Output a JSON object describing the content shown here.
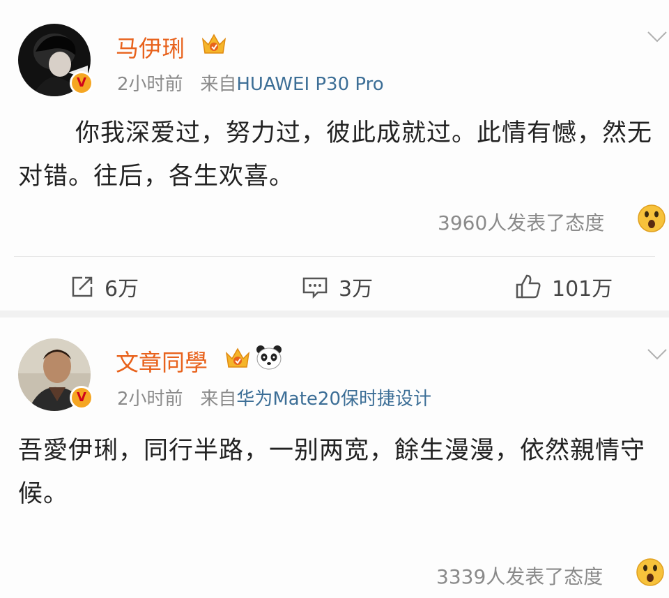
{
  "posts": [
    {
      "username": "马伊琍",
      "time": "2小时前",
      "source_prefix": "来自",
      "source": "HUAWEI P30 Pro",
      "content": "你我深爱过，努力过，彼此成就过。此情有憾，然无对错。往后，各生欢喜。",
      "reactions": "3960人发表了态度",
      "actions": {
        "repost": "6万",
        "comment": "3万",
        "like": "101万"
      },
      "badge_icon": "crown-badge-icon",
      "verified_icon": "verified-v-icon"
    },
    {
      "username": "文章同學",
      "time": "2小时前",
      "source_prefix": "来自",
      "source": "华为Mate20保时捷设计",
      "content": "吾愛伊琍，同行半路，一别两宽，餘生漫漫，依然親情守候。",
      "reactions": "3339人发表了态度",
      "badge_icon": "crown-badge-icon",
      "extra_icon": "panda-icon",
      "verified_icon": "verified-v-icon"
    }
  ],
  "colors": {
    "username": "#e8621c",
    "meta": "#8a8a8a",
    "source": "#3c6e96",
    "text": "#222222",
    "badge": "#f5a623"
  },
  "verified_letter": "V"
}
